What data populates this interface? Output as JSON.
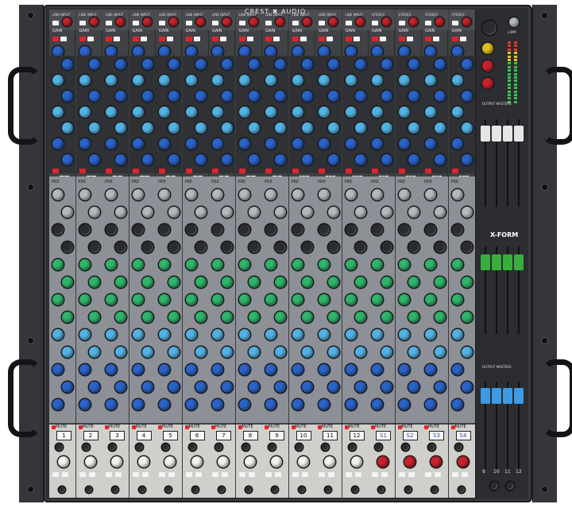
{
  "brand": {
    "name": "CREST",
    "sub": "AUDIO"
  },
  "top_labels": {
    "gain": "GAIN",
    "line_input": "LINE INPUT",
    "stereo": "STEREO",
    "lamp": "LAMP"
  },
  "strip_labels": {
    "mute": "MUTE",
    "mix_sends": "MIX SENDS",
    "pre": "PRE"
  },
  "channels": [
    "1",
    "2",
    "3",
    "4",
    "5",
    "6",
    "7",
    "8",
    "9",
    "10",
    "11",
    "12",
    "S1",
    "S2",
    "S3",
    "S4"
  ],
  "master": {
    "output_masters": "OUTPUT MASTERS",
    "xform": "X-FORM",
    "bus_numbers": [
      "9",
      "10",
      "11",
      "12"
    ]
  },
  "colors": {
    "red": "#c8232c",
    "blue": "#2b63c9",
    "light_blue": "#54b2e2",
    "green": "#2fb46a",
    "grey": "#b5b8bd"
  }
}
